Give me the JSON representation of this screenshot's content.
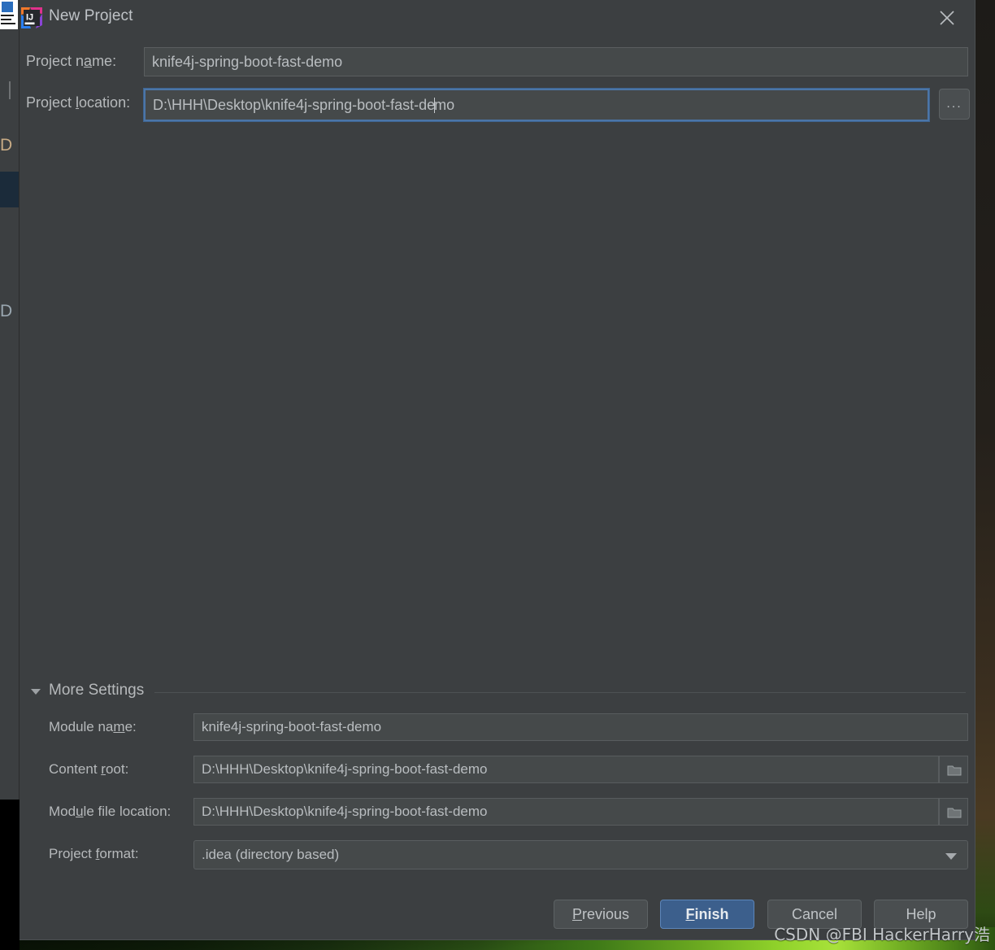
{
  "window": {
    "title": "New Project",
    "logo_icon": "intellij-idea-logo",
    "close_icon": "close-icon"
  },
  "form": {
    "project_name": {
      "label_pre": "Project n",
      "label_mnemonic": "a",
      "label_post": "me:",
      "value": "knife4j-spring-boot-fast-demo",
      "placeholder": "Project name"
    },
    "project_location": {
      "label_pre": "Project ",
      "label_mnemonic": "l",
      "label_post": "ocation:",
      "value_before_caret": "D:\\HHH\\Desktop\\knife4j-spring-boot-fast-de",
      "value_after_caret": "mo",
      "value": "D:\\HHH\\Desktop\\knife4j-spring-boot-fast-demo",
      "placeholder": "Project location",
      "browse_label": "...",
      "browse_icon": "ellipsis-icon"
    }
  },
  "more_settings": {
    "header_pre": "Mor",
    "header_mnemonic": "e",
    "header_post": " Settings",
    "expanded": true,
    "caret_icon": "chevron-down-icon",
    "rows": [
      {
        "label_pre": "Module na",
        "label_mnemonic": "m",
        "label_post": "e:",
        "value": "knife4j-spring-boot-fast-demo",
        "has_folder_button": false
      },
      {
        "label_pre": "Content ",
        "label_mnemonic": "r",
        "label_post": "oot:",
        "value": "D:\\HHH\\Desktop\\knife4j-spring-boot-fast-demo",
        "has_folder_button": true,
        "folder_icon": "folder-icon"
      },
      {
        "label_pre": "Mod",
        "label_mnemonic": "u",
        "label_post": "le file location:",
        "value": "D:\\HHH\\Desktop\\knife4j-spring-boot-fast-demo",
        "has_folder_button": true,
        "folder_icon": "folder-icon"
      }
    ],
    "project_format": {
      "label_pre": "Project ",
      "label_mnemonic": "f",
      "label_post": "ormat:",
      "selected": ".idea (directory based)",
      "chevron_icon": "chevron-down-icon"
    }
  },
  "buttons": {
    "previous": {
      "pre": "",
      "mnemonic": "P",
      "post": "revious"
    },
    "finish": {
      "pre": "",
      "mnemonic": "F",
      "post": "inish"
    },
    "cancel": {
      "pre": "Cancel",
      "mnemonic": "",
      "post": ""
    },
    "help": {
      "pre": "Help",
      "mnemonic": "",
      "post": ""
    }
  },
  "watermark": {
    "text": "CSDN @FBI HackerHarry浩"
  },
  "colors": {
    "dialog_bg": "#3c3f41",
    "field_bg": "#45494a",
    "field_border": "#5a5e60",
    "focus_border": "#4b76a8",
    "text": "#b6b9bb",
    "primary_button_bg": "#3c5f8c",
    "primary_button_border": "#5c86ba"
  }
}
